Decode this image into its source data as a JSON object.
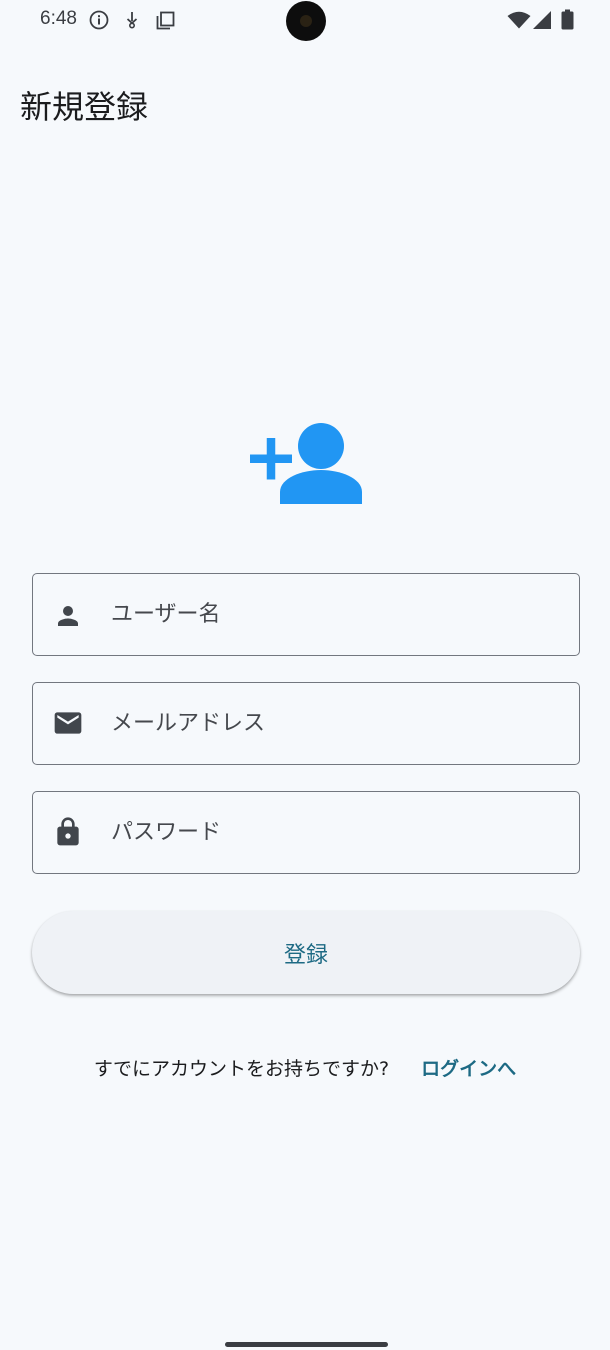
{
  "status_bar": {
    "time": "6:48",
    "icons": [
      "info-icon",
      "usb-debug-icon",
      "copy-icon",
      "wifi-icon",
      "signal-icon",
      "battery-icon"
    ]
  },
  "app": {
    "title": "新規登録"
  },
  "header_icon": "add-user-icon",
  "form": {
    "username": {
      "placeholder": "ユーザー名",
      "value": "",
      "icon": "person-icon"
    },
    "email": {
      "placeholder": "メールアドレス",
      "value": "",
      "icon": "mail-icon"
    },
    "password": {
      "placeholder": "パスワード",
      "value": "",
      "icon": "lock-icon"
    }
  },
  "actions": {
    "register_label": "登録",
    "login_question": "すでにアカウントをお持ちですか?",
    "login_link": "ログインへ"
  },
  "colors": {
    "background": "#f6f9fc",
    "accent_icon": "#2196f3",
    "link": "#1d6a84",
    "field_border": "#72777f",
    "field_icon": "#41464c"
  }
}
